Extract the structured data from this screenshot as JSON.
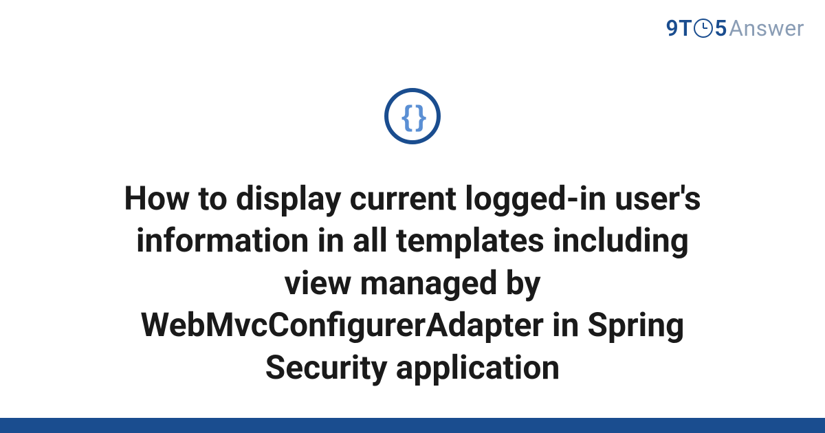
{
  "logo": {
    "part1": "9T",
    "part2": "5",
    "part3": "Answer"
  },
  "icon": {
    "braces": "{ }"
  },
  "title": "How to display current logged-in user's information in all templates including view managed by WebMvcConfigurerAdapter in Spring Security application"
}
